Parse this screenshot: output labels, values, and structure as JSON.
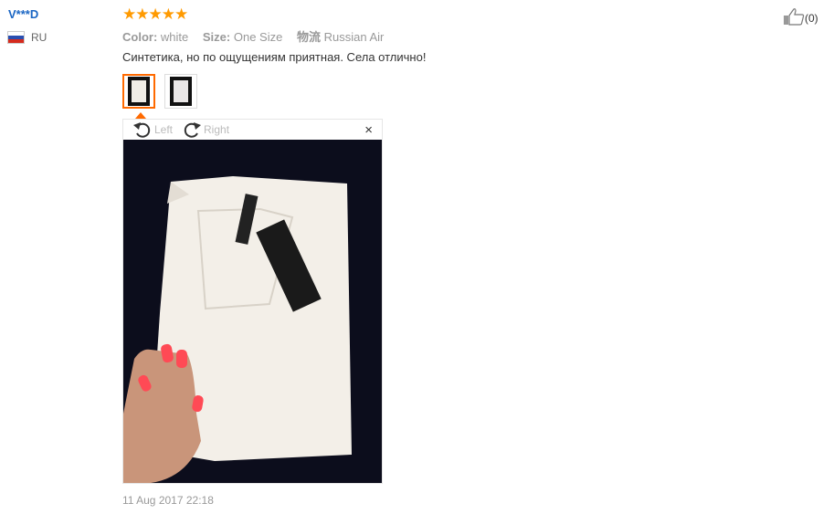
{
  "review": {
    "user_name": "V***D",
    "country": "RU",
    "stars": "★★★★★",
    "color_label": "Color:",
    "color_value": "white",
    "size_label": "Size:",
    "size_value": "One Size",
    "shipping_label": "物流",
    "shipping_value": "Russian Air",
    "text": "Синтетика, но по ощущениям приятная. Села отлично!",
    "helpful_count": "(0)",
    "date": "11 Aug 2017 22:18"
  },
  "viewer": {
    "rotate_left": "Left",
    "rotate_right": "Right",
    "close": "×"
  },
  "icons": {
    "flag": "russia-flag-icon",
    "helpful": "thumbs-up-icon",
    "rotate_left": "rotate-left-icon",
    "rotate_right": "rotate-right-icon",
    "close": "close-icon"
  },
  "colors": {
    "user_link": "#1a66c4",
    "stars": "#ff9a00",
    "active_thumb": "#ff6a00",
    "photo_bg": "#0c0d1c"
  }
}
